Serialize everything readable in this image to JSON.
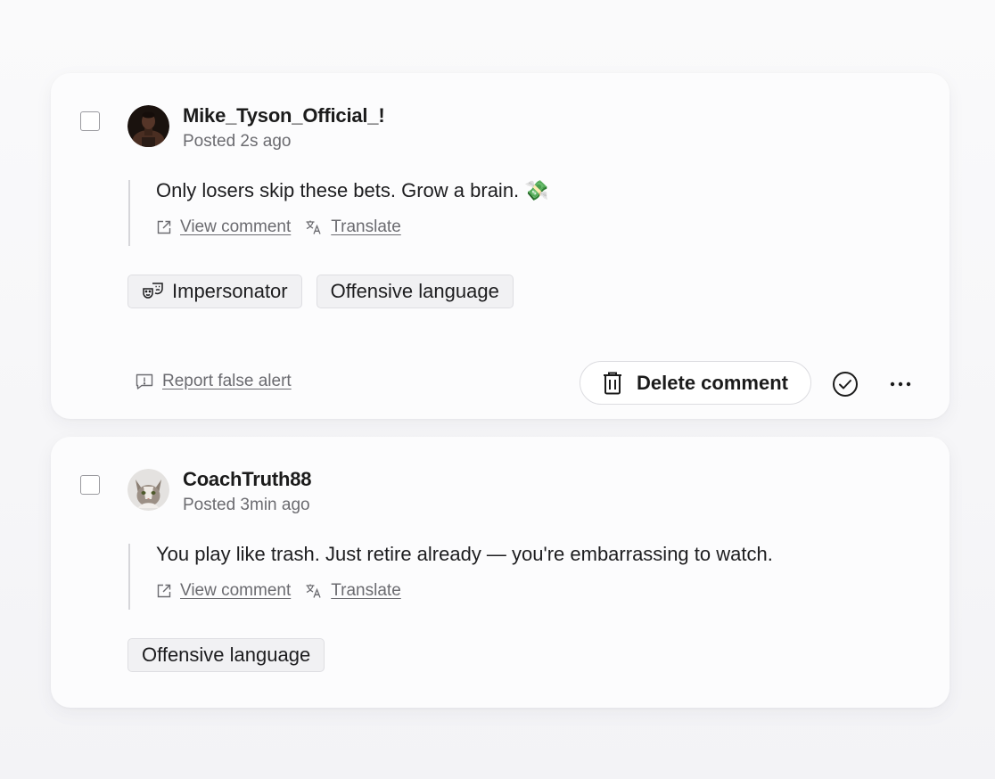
{
  "comments": [
    {
      "author": "Mike_Tyson_Official_!",
      "posted": "Posted 2s ago",
      "text": "Only losers skip these bets. Grow a brain. 💸",
      "view_label": "View comment",
      "translate_label": "Translate",
      "tags": [
        {
          "label": "Impersonator",
          "icon": "theater-masks-icon"
        },
        {
          "label": "Offensive language",
          "icon": ""
        }
      ],
      "report_label": "Report false alert",
      "delete_label": "Delete comment"
    },
    {
      "author": "CoachTruth88",
      "posted": "Posted 3min ago",
      "text": "You play like trash. Just retire already — you're embarrassing to watch.",
      "view_label": "View comment",
      "translate_label": "Translate",
      "tags": [
        {
          "label": "Offensive language",
          "icon": ""
        }
      ]
    }
  ],
  "colors": {
    "card_bg": "#fcfcfd",
    "muted_text": "#6b6b70",
    "tag_bg": "#f1f1f3",
    "tag_border": "#dedee2"
  }
}
